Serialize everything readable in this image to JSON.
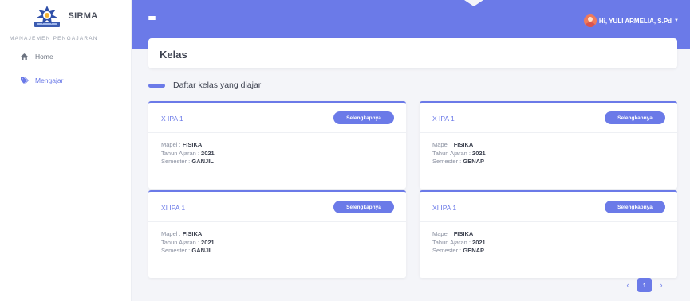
{
  "sidebar": {
    "brand": "SIRMA",
    "section_label": "MANAJEMEN PENGAJARAN",
    "items": [
      {
        "label": "Home",
        "icon": "home-icon",
        "active": false
      },
      {
        "label": "Mengajar",
        "icon": "tags-icon",
        "active": true
      }
    ]
  },
  "topbar": {
    "user": "Hi, YULI ARMELIA, S.Pd",
    "caret": "▼"
  },
  "page": {
    "title": "Kelas",
    "section": "Daftar kelas yang diajar"
  },
  "cards": [
    {
      "class": "X IPA 1",
      "button": "Selengkapnya",
      "mapel_label": "Mapel :",
      "mapel": "FISIKA",
      "tahun_label": "Tahun Ajaran :",
      "tahun": "2021",
      "semester_label": "Semester :",
      "semester": "GANJIL"
    },
    {
      "class": "X IPA 1",
      "button": "Selengkapnya",
      "mapel_label": "Mapel :",
      "mapel": "FISIKA",
      "tahun_label": "Tahun Ajaran :",
      "tahun": "2021",
      "semester_label": "Semester :",
      "semester": "GENAP"
    },
    {
      "class": "XI IPA 1",
      "button": "Selengkapnya",
      "mapel_label": "Mapel :",
      "mapel": "FISIKA",
      "tahun_label": "Tahun Ajaran :",
      "tahun": "2021",
      "semester_label": "Semester :",
      "semester": "GANJIL"
    },
    {
      "class": "XI IPA 1",
      "button": "Selengkapnya",
      "mapel_label": "Mapel :",
      "mapel": "FISIKA",
      "tahun_label": "Tahun Ajaran :",
      "tahun": "2021",
      "semester_label": "Semester :",
      "semester": "GENAP"
    }
  ],
  "pagination": {
    "prev": "‹",
    "current": "1",
    "next": "›"
  },
  "colors": {
    "accent": "#6b7ae8",
    "background": "#f4f5f9"
  }
}
